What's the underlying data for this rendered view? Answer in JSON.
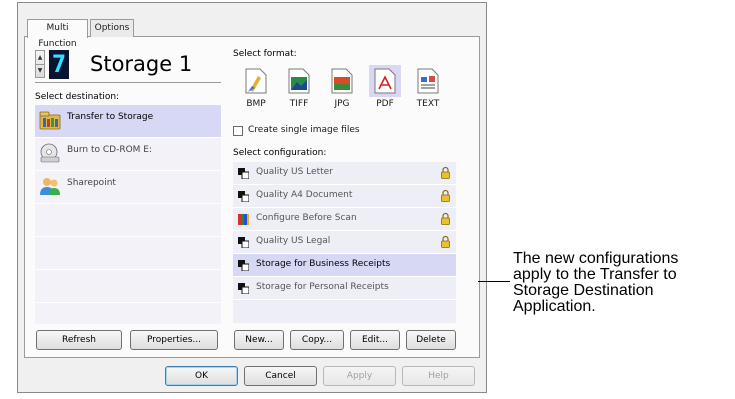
{
  "tabs": [
    {
      "label": "Multi Function",
      "active": true
    },
    {
      "label": "Options",
      "active": false
    }
  ],
  "storage": {
    "number": "7",
    "name": "Storage 1"
  },
  "destination": {
    "label": "Select destination:",
    "items": [
      {
        "label": "Transfer to Storage",
        "icon": "folder-storage-icon",
        "selected": true
      },
      {
        "label": "Burn to CD-ROM  E:",
        "icon": "cd-burner-icon",
        "selected": false
      },
      {
        "label": "Sharepoint",
        "icon": "sharepoint-people-icon",
        "selected": false
      }
    ]
  },
  "format": {
    "label": "Select format:",
    "options": [
      {
        "label": "BMP",
        "icon": "bmp-file-icon",
        "selected": false
      },
      {
        "label": "TIFF",
        "icon": "tiff-file-icon",
        "selected": false
      },
      {
        "label": "JPG",
        "icon": "jpg-file-icon",
        "selected": false
      },
      {
        "label": "PDF",
        "icon": "pdf-file-icon",
        "selected": true
      },
      {
        "label": "TEXT",
        "icon": "text-file-icon",
        "selected": false
      }
    ],
    "single_image_label": "Create single image files",
    "single_image_checked": false
  },
  "configuration": {
    "label": "Select configuration:",
    "items": [
      {
        "label": "Quality US Letter",
        "icon": "scanner-config-icon",
        "locked": true,
        "selected": false
      },
      {
        "label": "Quality A4 Document",
        "icon": "scanner-config-icon",
        "locked": true,
        "selected": false
      },
      {
        "label": "Configure Before Scan",
        "icon": "configure-palette-icon",
        "locked": true,
        "selected": false
      },
      {
        "label": "Quality US Legal",
        "icon": "scanner-config-icon",
        "locked": true,
        "selected": false
      },
      {
        "label": "Storage for Business Receipts",
        "icon": "scanner-config-icon",
        "locked": false,
        "selected": true
      },
      {
        "label": "Storage for Personal Receipts",
        "icon": "scanner-config-icon",
        "locked": false,
        "selected": false
      }
    ]
  },
  "buttons": {
    "refresh": "Refresh",
    "properties": "Properties...",
    "new": "New...",
    "copy": "Copy...",
    "edit": "Edit...",
    "delete": "Delete",
    "ok": "OK",
    "cancel": "Cancel",
    "apply": "Apply",
    "help": "Help"
  },
  "callout": {
    "lines": [
      "The new configurations",
      "apply to the Transfer to",
      "Storage Destination",
      "Application."
    ]
  },
  "colors": {
    "selection": "#d6d8f4",
    "list_background": "#f2f2f8",
    "digit_text": "#2fe2ff",
    "digit_background": "#0a1430"
  }
}
